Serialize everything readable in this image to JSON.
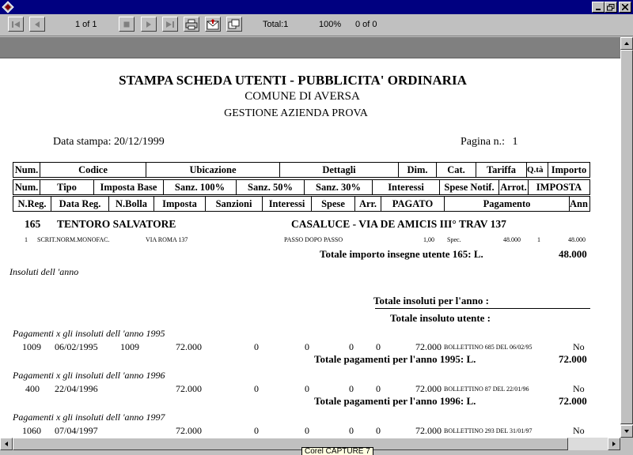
{
  "toolbar": {
    "page_indicator": "1 of 1",
    "total": "Total:1",
    "zoom": "100%",
    "search_count": "0 of 0"
  },
  "report": {
    "title": "STAMPA SCHEDA UTENTI - PUBBLICITA' ORDINARIA",
    "subtitle": "COMUNE DI AVERSA",
    "subtitle2": "GESTIONE AZIENDA PROVA",
    "print_date_label": "Data stampa:",
    "print_date": "20/12/1999",
    "page_label": "Pagina n.:",
    "page_number": "1",
    "header_row1": [
      "Num.",
      "Codice",
      "Ubicazione",
      "Dettagli",
      "Dim.",
      "Cat.",
      "Tariffa",
      "Q.tà",
      "Importo"
    ],
    "header_row2": [
      "Num.",
      "Tipo",
      "Imposta Base",
      "Sanz. 100%",
      "Sanz. 50%",
      "Sanz. 30%",
      "Interessi",
      "Spese Notif.",
      "Arrot.",
      "IMPOSTA"
    ],
    "header_row3": [
      "N.Reg.",
      "Data Reg.",
      "N.Bolla",
      "Imposta",
      "Sanzioni",
      "Interessi",
      "Spese",
      "Arr.",
      "PAGATO",
      "Pagamento",
      "Ann"
    ],
    "user": {
      "number": "165",
      "name": "TENTORO SALVATORE",
      "address": "CASALUCE - VIA DE AMICIS III° TRAV 137"
    },
    "sign_line": {
      "num": "1",
      "type": "SCRIT.NORM.MONOFAC.",
      "location": "VIA ROMA 137",
      "details": "PASSO DOPO PASSO",
      "dim": "1,00",
      "cat": "Spec.",
      "tariff": "48.000",
      "qty": "1",
      "amount": "48.000"
    },
    "total_signs_label": "Totale importo insegne utente 165:  L.",
    "total_signs_value": "48.000",
    "unpaid_year_label": "Insoluti dell 'anno",
    "total_unpaid_year_label": "Totale insoluti per l'anno :",
    "total_unpaid_user_label": "Totale insoluto utente :",
    "payment_groups": [
      {
        "heading": "Pagamenti x gli insoluti dell 'anno 1995",
        "row": {
          "nreg": "1009",
          "date": "06/02/1995",
          "bolla": "1009",
          "imposta": "72.000",
          "sanzioni": "0",
          "interessi": "0",
          "spese": "0",
          "arr": "0",
          "pagato": "72.000",
          "pagamento": "BOLLETTINO 685 DEL 06/02/95",
          "ann": "No"
        },
        "total_label": "Totale pagamenti per l'anno 1995:  L.",
        "total_value": "72.000"
      },
      {
        "heading": "Pagamenti x gli insoluti dell 'anno 1996",
        "row": {
          "nreg": "400",
          "date": "22/04/1996",
          "bolla": "",
          "imposta": "72.000",
          "sanzioni": "0",
          "interessi": "0",
          "spese": "0",
          "arr": "0",
          "pagato": "72.000",
          "pagamento": "BOLLETTINO 87 DEL 22/01/96",
          "ann": "No"
        },
        "total_label": "Totale pagamenti per l'anno 1996:  L.",
        "total_value": "72.000"
      },
      {
        "heading": "Pagamenti x gli insoluti dell 'anno 1997",
        "row": {
          "nreg": "1060",
          "date": "07/04/1997",
          "bolla": "",
          "imposta": "72.000",
          "sanzioni": "0",
          "interessi": "0",
          "spese": "0",
          "arr": "0",
          "pagato": "72.000",
          "pagamento": "BOLLETTINO 293 DEL 31/01/97",
          "ann": "No"
        }
      }
    ]
  },
  "tooltip": "Corel CAPTURE 7",
  "colors": {
    "titlebar": "#000080",
    "chrome": "#c0c0c0",
    "graybar": "#808080",
    "page": "#ffffff"
  }
}
